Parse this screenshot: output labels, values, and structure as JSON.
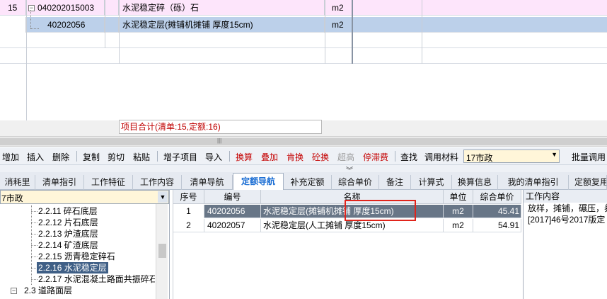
{
  "top_grid": {
    "rows": [
      {
        "index": "15",
        "code": "040202015003",
        "name": "水泥稳定碎（砾）石",
        "unit": "m2"
      },
      {
        "index": "",
        "code": "40202056",
        "name": "水泥稳定层(摊铺机摊铺 厚度15cm)",
        "unit": "m2"
      }
    ]
  },
  "summary": {
    "text": "项目合计(清单:15,定额:16)"
  },
  "toolbar": {
    "add": "增加",
    "insert": "插入",
    "delete": "删除",
    "copy": "复制",
    "cut": "剪切",
    "paste": "粘贴",
    "add_subitem": "增子项目",
    "import": "导入",
    "convert": "换算",
    "stack": "叠加",
    "fertilizer": "肯换",
    "concrete": "砼换",
    "overheight": "超高",
    "stall_fee": "停滞费",
    "find": "查找",
    "call_material": "调用材料",
    "region": "17市政",
    "batch_call": "批量调用"
  },
  "tabs": [
    {
      "label": "消耗里"
    },
    {
      "label": "清单指引"
    },
    {
      "label": "工作特征"
    },
    {
      "label": "工作内容"
    },
    {
      "label": "清单导航"
    },
    {
      "label": "定额导航"
    },
    {
      "label": "补充定额"
    },
    {
      "label": "综合单价"
    },
    {
      "label": "备注"
    },
    {
      "label": "计算式"
    },
    {
      "label": "换算信息"
    },
    {
      "label": "我的清单指引"
    },
    {
      "label": "定额复用"
    }
  ],
  "tree": {
    "combo_value": "7市政",
    "items": [
      {
        "label": "2.2.11 碎石底层"
      },
      {
        "label": "2.2.12 片石底层"
      },
      {
        "label": "2.2.13 炉渣底层"
      },
      {
        "label": "2.2.14 矿渣底层"
      },
      {
        "label": "2.2.15 沥青稳定碎石"
      },
      {
        "label": "2.2.16 水泥稳定层"
      },
      {
        "label": "2.2.17 水泥混凝土路面共振碎石"
      },
      {
        "label": "2.3 道路面层"
      }
    ]
  },
  "quota_table": {
    "headers": {
      "seq": "序号",
      "code": "编号",
      "name": "名称",
      "unit": "单位",
      "price": "综合单价"
    },
    "rows": [
      {
        "seq": "1",
        "code": "40202056",
        "name": "水泥稳定层(摊铺机摊铺 厚度15cm)",
        "unit": "m2",
        "price": "45.41"
      },
      {
        "seq": "2",
        "code": "40202057",
        "name": "水泥稳定层(人工摊铺 厚度15cm)",
        "unit": "m2",
        "price": "54.91"
      }
    ]
  },
  "work_content": {
    "title": "工作内容",
    "text": "放样，摊铺，碾压，养\n[2017]46号2017版定"
  }
}
